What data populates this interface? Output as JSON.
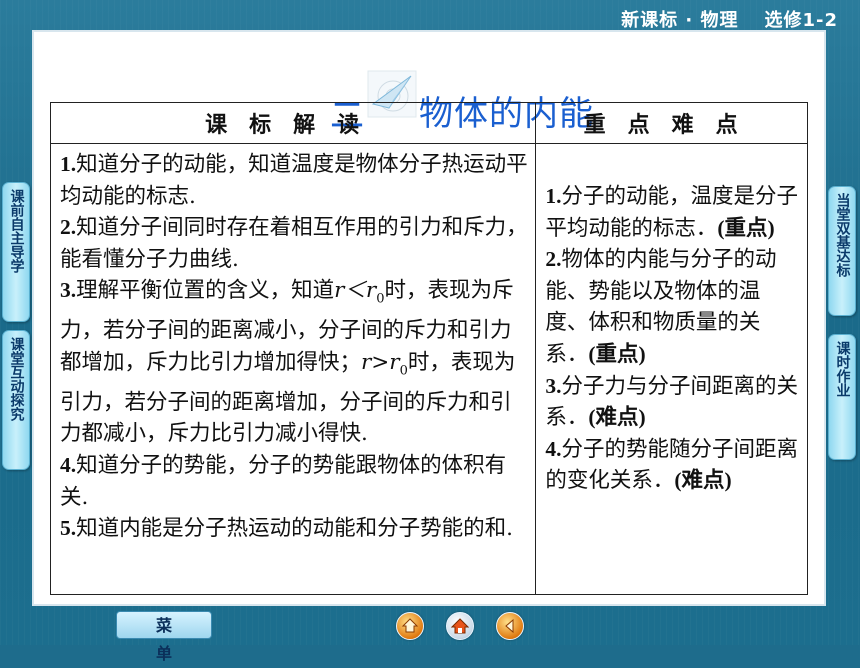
{
  "header": {
    "series": "新课标 · 物理",
    "volume": "选修1-2"
  },
  "title": {
    "number": "二",
    "text": "物体的内能"
  },
  "table": {
    "headers": [
      "课标解读",
      "重点难点"
    ],
    "left_items": [
      {
        "num": "1.",
        "text": "知道分子的动能，知道温度是物体分子热运动平均动能的标志."
      },
      {
        "num": "2.",
        "text": "知道分子间同时存在着相互作用的引力和斥力，能看懂分子力曲线."
      },
      {
        "num": "3.",
        "text_a": "理解平衡位置的含义，知道",
        "var1": "r＜r",
        "sub1": "0",
        "text_b": "时，表现为斥力，若分子间的距离减小，分子间的斥力和引力都增加，斥力比引力增加得快；",
        "var2": "r>r",
        "sub2": "0",
        "text_c": "时，表现为引力，若分子间的距离增加，分子间的斥力和引力都减小，斥力比引力减小得快."
      },
      {
        "num": "4.",
        "text": "知道分子的势能，分子的势能跟物体的体积有关."
      },
      {
        "num": "5.",
        "text": "知道内能是分子热运动的动能和分子势能的和."
      }
    ],
    "right_items": [
      {
        "num": "1.",
        "text": "分子的动能，温度是分子平均动能的标志．",
        "tag": "(重点)"
      },
      {
        "num": "2.",
        "text": "物体的内能与分子的动能、势能以及物体的温度、体积和物质量的关系．",
        "tag": "(重点)"
      },
      {
        "num": "3.",
        "text": "分子力与分子间距离的关系．",
        "tag": "(难点)"
      },
      {
        "num": "4.",
        "text": "分子的势能随分子间距离的变化关系．",
        "tag": "(难点)"
      }
    ]
  },
  "side_tabs": {
    "left": [
      "课前自主导学",
      "课堂互动探究"
    ],
    "right": [
      "当堂双基达标",
      "课时作业"
    ]
  },
  "footer": {
    "menu_label": "菜单"
  },
  "icons": {
    "nav": [
      "home-icon",
      "house-icon",
      "back-icon"
    ]
  },
  "colors": {
    "background": "#1e6c8c",
    "title": "#1a5fd0",
    "tab": "#c8f0fb"
  }
}
